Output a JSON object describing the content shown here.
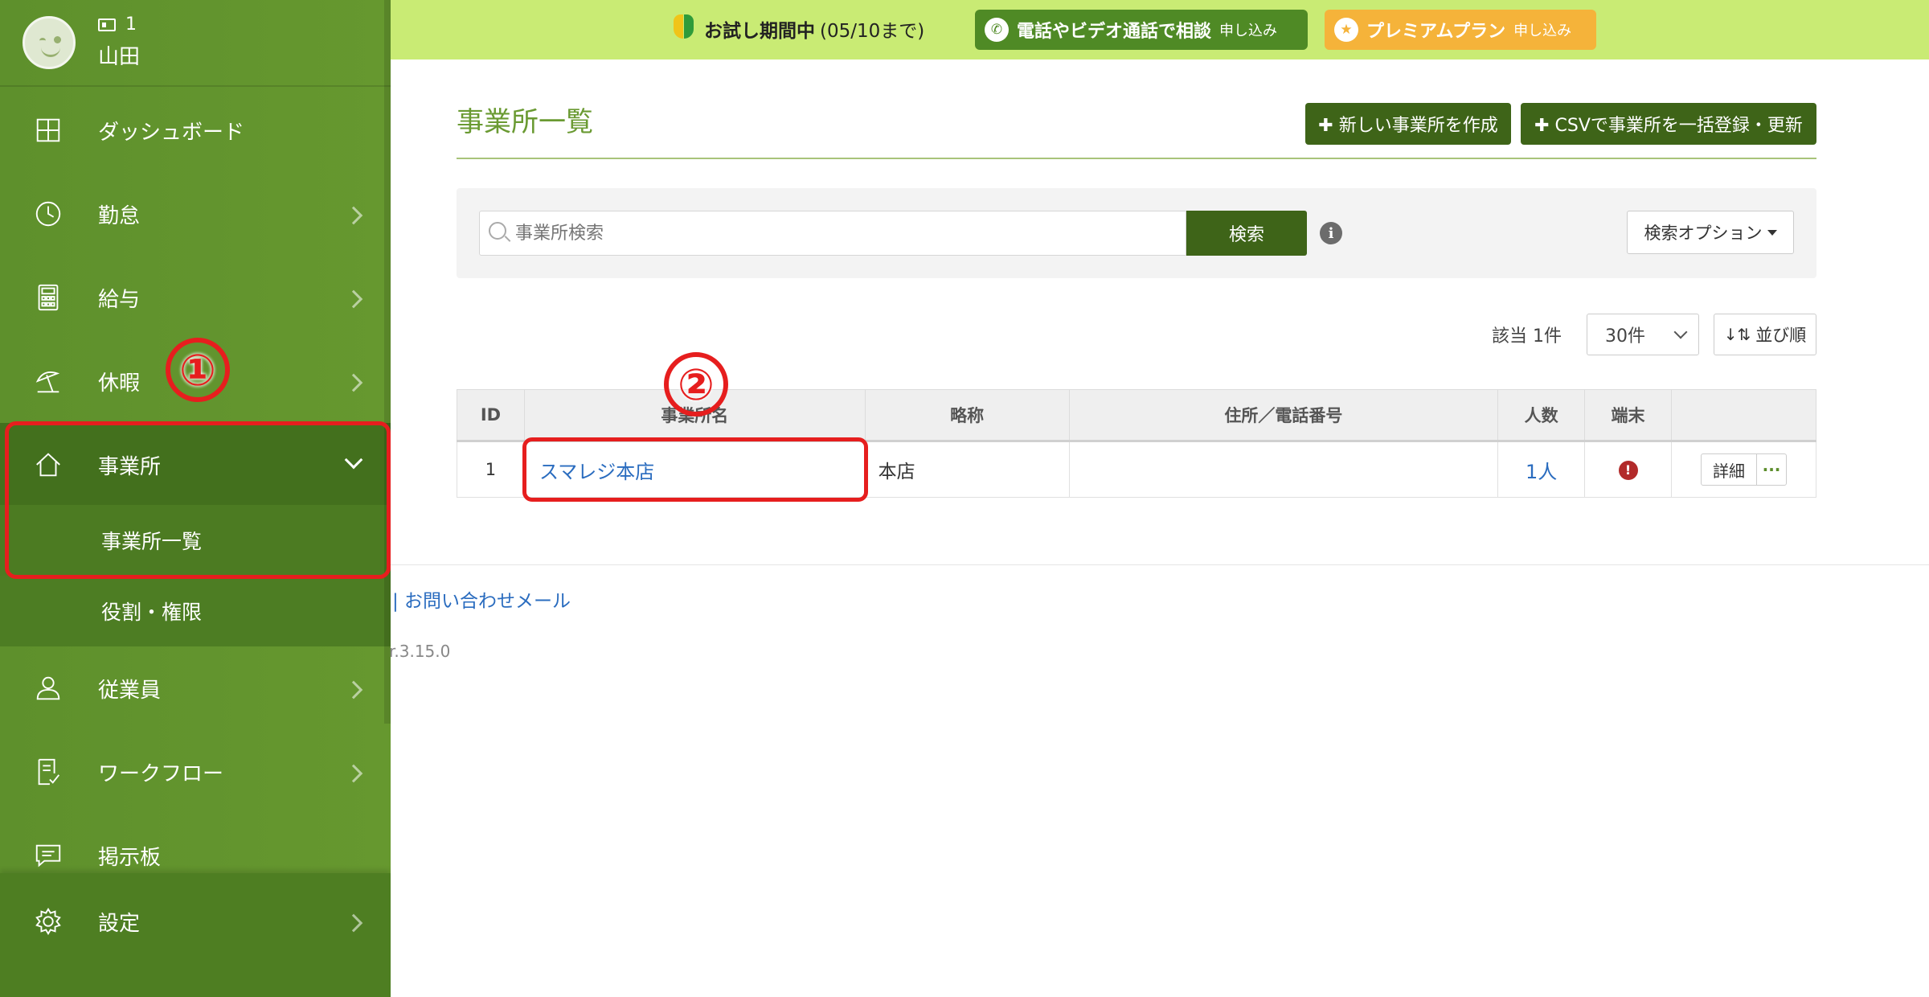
{
  "user": {
    "id_badge": "1",
    "name": "山田"
  },
  "sidebar": {
    "items": [
      {
        "label": "ダッシュボード",
        "icon": "dashboard-icon"
      },
      {
        "label": "勤怠",
        "icon": "clock-icon"
      },
      {
        "label": "給与",
        "icon": "calculator-icon"
      },
      {
        "label": "休暇",
        "icon": "beach-umbrella-icon"
      },
      {
        "label": "事業所",
        "icon": "home-icon"
      },
      {
        "label": "従業員",
        "icon": "person-icon"
      },
      {
        "label": "ワークフロー",
        "icon": "checklist-icon"
      },
      {
        "label": "掲示板",
        "icon": "message-icon"
      },
      {
        "label": "設定",
        "icon": "gear-icon"
      }
    ],
    "sub_items": [
      {
        "label": "事業所一覧"
      },
      {
        "label": "役割・権限"
      }
    ]
  },
  "annotations": {
    "step1": "①",
    "step2": "②"
  },
  "banner": {
    "trial_label": "お試し期間中",
    "trial_until": "(05/10まで)",
    "consult_label": "電話やビデオ通話で相談",
    "consult_sub": "申し込み",
    "premium_label": "プレミアムプラン",
    "premium_sub": "申し込み"
  },
  "page": {
    "title": "事業所一覧",
    "new_button": "✚ 新しい事業所を作成",
    "csv_button": "✚ CSVで事業所を一括登録・更新"
  },
  "search": {
    "placeholder": "事業所検索",
    "button": "検索",
    "options_label": "検索オプション"
  },
  "listing": {
    "count": "該当 1件",
    "per_page": "30件",
    "sort_label": "並び順"
  },
  "table": {
    "headers": [
      "ID",
      "事業所名",
      "略称",
      "住所／電話番号",
      "人数",
      "端末",
      ""
    ],
    "rows": [
      {
        "id": "1",
        "name": "スマレジ本店",
        "short": "本店",
        "address": "",
        "people": "1人",
        "terminal_warning": "!",
        "detail": "詳細",
        "more": "···"
      }
    ]
  },
  "footer": {
    "link": "| お問い合わせメール",
    "version": "r.3.15.0"
  },
  "colors": {
    "sidebar": "#66982f",
    "banner": "#c9eb74",
    "primary_dark": "#3e6418",
    "accent_title": "#6a9a32",
    "annotation": "#e61e1e",
    "premium": "#f5b33a"
  }
}
